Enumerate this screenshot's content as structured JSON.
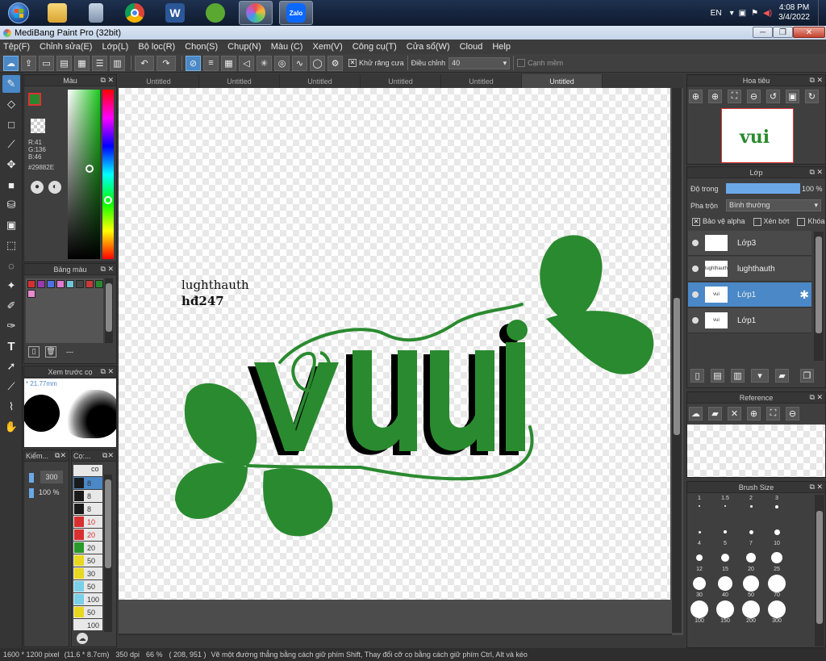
{
  "taskbar": {
    "apps": [
      {
        "name": "start",
        "label": ""
      },
      {
        "name": "explorer",
        "label": ""
      },
      {
        "name": "calculator",
        "label": ""
      },
      {
        "name": "chrome",
        "label": ""
      },
      {
        "name": "word",
        "label": "W"
      },
      {
        "name": "coccoc",
        "label": ""
      },
      {
        "name": "medibang",
        "label": ""
      },
      {
        "name": "zalo",
        "label": "Zalo"
      }
    ],
    "language": "EN",
    "time": "4:08 PM",
    "date": "3/4/2022"
  },
  "window": {
    "title": "MediBang Paint Pro (32bit)"
  },
  "menu": [
    "Tệp(F)",
    "Chỉnh sửa(E)",
    "Lớp(L)",
    "Bộ lọc(R)",
    "Chọn(S)",
    "Chụp(N)",
    "Màu (C)",
    "Xem(V)",
    "Công cụ(T)",
    "Cửa sổ(W)",
    "Cloud",
    "Help"
  ],
  "toolbar": {
    "antialias_label": "Khử răng cưa",
    "adjust_label": "Điều chỉnh",
    "adjust_value": "40",
    "smooth_label": "Cạnh mềm"
  },
  "tabs": [
    "Untitled",
    "Untitled",
    "Untitled",
    "Untitled",
    "Untitled",
    "Untitled"
  ],
  "color_panel": {
    "title": "Màu",
    "r": "R:41",
    "g": "G:136",
    "b": "B:46",
    "hex": "#29882E",
    "current_color": "#29882E"
  },
  "palette_panel": {
    "title": "Bảng màu",
    "swatches": [
      "#d43030",
      "#9b3ab0",
      "#4f70e0",
      "#e07ad0",
      "#6fc6d8",
      "#444444",
      "#c83a3a",
      "#29882e",
      "#e88ad0"
    ],
    "name": "---"
  },
  "brush_preview": {
    "title": "Xem trước cọ",
    "size": "* 21.77mm"
  },
  "brush_props": {
    "title": "Kiểm...",
    "size": "300",
    "opacity": "100 %"
  },
  "brush_list": {
    "title": "Cọ:...",
    "header": "co",
    "items": [
      {
        "color": "#1a1a1a",
        "size": "8",
        "selected": true
      },
      {
        "color": "#1a1a1a",
        "size": "8"
      },
      {
        "color": "#1a1a1a",
        "size": "8"
      },
      {
        "color": "#d83030",
        "size": "10"
      },
      {
        "color": "#d83030",
        "size": "20"
      },
      {
        "color": "#2a9a2a",
        "size": "20"
      },
      {
        "color": "#e8d820",
        "size": "50"
      },
      {
        "color": "#e8d820",
        "size": "30"
      },
      {
        "color": "#7ad0e8",
        "size": "50"
      },
      {
        "color": "#7ad0e8",
        "size": "100"
      },
      {
        "color": "#e8d820",
        "size": "50"
      },
      {
        "color": "#e8e8e8",
        "size": "100"
      }
    ]
  },
  "canvas": {
    "text_line1": "lughthauth",
    "text_line2": "hđ247",
    "word": "vui",
    "green": "#2a8a2f"
  },
  "navigator": {
    "title": "Hoa tiêu"
  },
  "layers_panel": {
    "title": "Lớp",
    "opacity_label": "Độ trong",
    "opacity_value": "100 %",
    "blend_label": "Pha trộn",
    "blend_value": "Bình thường",
    "protect_alpha": "Bảo vệ alpha",
    "clip": "Xén bớt",
    "lock": "Khóa",
    "layers": [
      {
        "name": "Lớp3",
        "thumb": ""
      },
      {
        "name": "lughthauth",
        "thumb": "lughthauth"
      },
      {
        "name": "Lớp1",
        "thumb": "vui",
        "selected": true
      },
      {
        "name": "Lớp1",
        "thumb": "vui"
      }
    ]
  },
  "reference_panel": {
    "title": "Reference"
  },
  "brush_size_panel": {
    "title": "Brush Size",
    "sizes": [
      "1",
      "1.5",
      "2",
      "3",
      "4",
      "5",
      "7",
      "10",
      "12",
      "15",
      "20",
      "25",
      "30",
      "40",
      "50",
      "70",
      "100",
      "150",
      "200",
      "300"
    ]
  },
  "status": {
    "dimensions": "1600 * 1200 pixel",
    "physical": "(11.6 * 8.7cm)",
    "dpi": "350 dpi",
    "zoom": "66 %",
    "coords": "( 208, 951 )",
    "hint": "Vẽ một đường thẳng bằng cách giữ phím Shift, Thay đổi cỡ cọ bằng cách giữ phím Ctrl, Alt và kéo"
  }
}
